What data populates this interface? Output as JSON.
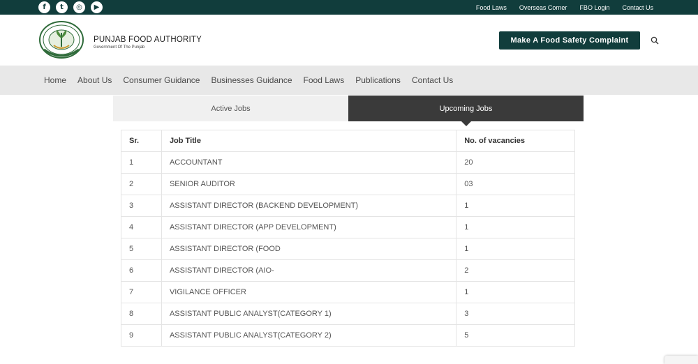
{
  "topbar": {
    "socials": [
      {
        "icon": "facebook-icon",
        "glyph": "f"
      },
      {
        "icon": "twitter-icon",
        "glyph": "t"
      },
      {
        "icon": "instagram-icon",
        "glyph": "◎"
      },
      {
        "icon": "youtube-icon",
        "glyph": "▶"
      }
    ],
    "links": [
      "Food Laws",
      "Overseas Corner",
      "FBO Login",
      "Contact Us"
    ]
  },
  "header": {
    "brand_name": "PUNJAB FOOD AUTHORITY",
    "brand_sub": "Government Of The Punjab",
    "complaint_label": "Make A Food Safety Complaint"
  },
  "nav": [
    "Home",
    "About Us",
    "Consumer Guidance",
    "Businesses Guidance",
    "Food Laws",
    "Publications",
    "Contact Us"
  ],
  "tabs": {
    "active_jobs": "Active Jobs",
    "upcoming_jobs": "Upcoming Jobs"
  },
  "table": {
    "headers": [
      "Sr.",
      "Job Title",
      "No. of vacancies"
    ],
    "rows": [
      [
        "1",
        "ACCOUNTANT",
        "20"
      ],
      [
        "2",
        "SENIOR AUDITOR",
        "03"
      ],
      [
        "3",
        "ASSISTANT DIRECTOR (BACKEND DEVELOPMENT)",
        "1"
      ],
      [
        "4",
        "ASSISTANT DIRECTOR (APP DEVELOPMENT)",
        "1"
      ],
      [
        "5",
        "ASSISTANT DIRECTOR (FOOD",
        "1"
      ],
      [
        "6",
        "ASSISTANT DIRECTOR (AIO-",
        "2"
      ],
      [
        "7",
        "VIGILANCE OFFICER",
        "1"
      ],
      [
        "8",
        "ASSISTANT PUBLIC ANALYST(CATEGORY 1)",
        "3"
      ],
      [
        "9",
        "ASSISTANT PUBLIC ANALYST(CATEGORY 2)",
        "5"
      ]
    ]
  },
  "colors": {
    "brand_dark": "#113d3c",
    "tab_dark": "#3a3a3a",
    "nav_bg": "#e8e8e8"
  }
}
